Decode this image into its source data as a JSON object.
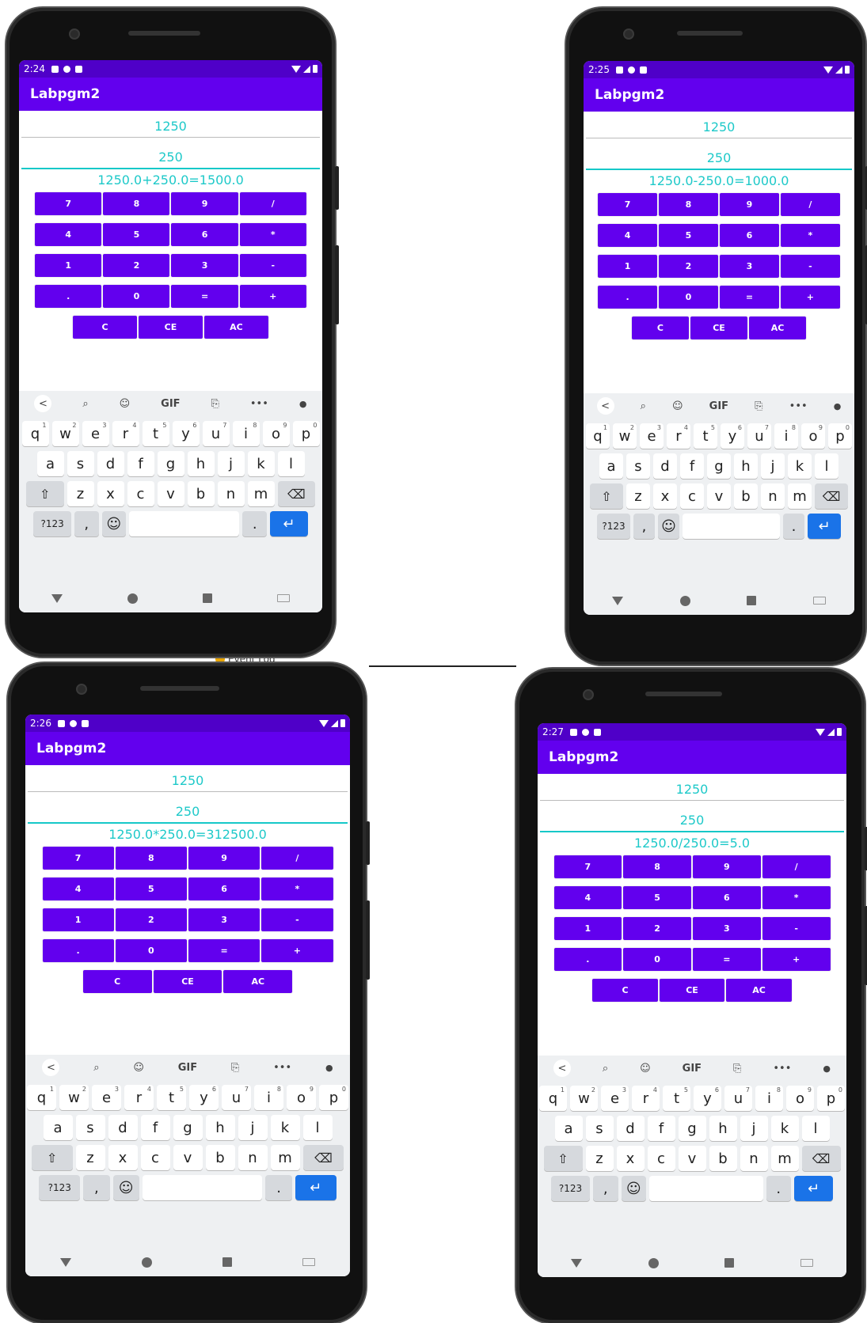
{
  "brand": {
    "primary": "#6200ee",
    "statusbar": "#4f00c8",
    "accent": "#1ec9c9",
    "keyboard_bg": "#eef0f2",
    "enter_key": "#1a73e8"
  },
  "app_title": "Labpgm2",
  "event_log_label": "Event Log",
  "calc_keys": [
    "7",
    "8",
    "9",
    "/",
    "4",
    "5",
    "6",
    "*",
    "1",
    "2",
    "3",
    "-",
    ".",
    "0",
    "=",
    "+"
  ],
  "clear_keys": [
    "C",
    "CE",
    "AC"
  ],
  "kb": {
    "toolbar": [
      "<",
      "search-icon",
      "sticker-icon",
      "GIF",
      "clipboard-icon",
      "•••",
      "mic-icon"
    ],
    "row1": [
      {
        "k": "q",
        "s": "1"
      },
      {
        "k": "w",
        "s": "2"
      },
      {
        "k": "e",
        "s": "3"
      },
      {
        "k": "r",
        "s": "4"
      },
      {
        "k": "t",
        "s": "5"
      },
      {
        "k": "y",
        "s": "6"
      },
      {
        "k": "u",
        "s": "7"
      },
      {
        "k": "i",
        "s": "8"
      },
      {
        "k": "o",
        "s": "9"
      },
      {
        "k": "p",
        "s": "0"
      }
    ],
    "row2": [
      "a",
      "s",
      "d",
      "f",
      "g",
      "h",
      "j",
      "k",
      "l"
    ],
    "row3": [
      "z",
      "x",
      "c",
      "v",
      "b",
      "n",
      "m"
    ],
    "sym_label": "?123",
    "comma": ",",
    "period": "."
  },
  "phones": [
    {
      "time": "2:24",
      "num1": "1250",
      "num2": "250",
      "result": "1250.0+250.0=1500.0"
    },
    {
      "time": "2:25",
      "num1": "1250",
      "num2": "250",
      "result": "1250.0-250.0=1000.0"
    },
    {
      "time": "2:26",
      "num1": "1250",
      "num2": "250",
      "result": "1250.0*250.0=312500.0"
    },
    {
      "time": "2:27",
      "num1": "1250",
      "num2": "250",
      "result": "1250.0/250.0=5.0"
    }
  ]
}
